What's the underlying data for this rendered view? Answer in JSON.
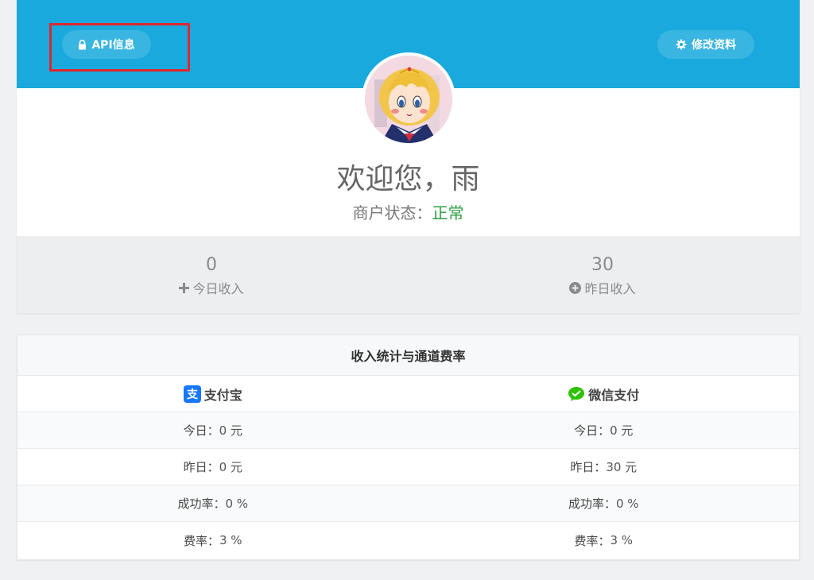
{
  "header": {
    "api_button_label": "API信息",
    "edit_button_label": "修改资料"
  },
  "profile": {
    "welcome_text": "欢迎您，雨",
    "status_label": "商户状态：",
    "status_value": "正常"
  },
  "stats": {
    "today_value": "0",
    "today_label": "今日收入",
    "yesterday_value": "30",
    "yesterday_label": "昨日收入"
  },
  "income_table": {
    "title": "收入统计与通道费率",
    "channels": [
      "支付宝",
      "微信支付"
    ],
    "rows": [
      {
        "alipay_label": "今日：",
        "alipay_value": "0 元",
        "wechat_label": "今日：",
        "wechat_value": "0 元"
      },
      {
        "alipay_label": "昨日：",
        "alipay_value": "0 元",
        "wechat_label": "昨日：",
        "wechat_value": "30 元"
      },
      {
        "alipay_label": "成功率：",
        "alipay_value": "0 %",
        "wechat_label": "成功率：",
        "wechat_value": "0 %"
      },
      {
        "alipay_label": "费率：",
        "alipay_value": "3 %",
        "wechat_label": "费率：",
        "wechat_value": "3 %"
      }
    ]
  },
  "colors": {
    "banner": "#19a9dc",
    "status_ok": "#2f9e44",
    "highlight": "#e0262f",
    "alipay": "#1677ff",
    "wechat": "#2dc100"
  },
  "icons": {
    "api": "lock-icon",
    "edit": "gear-icon",
    "today": "plus-icon",
    "yesterday": "plus-circle-icon",
    "alipay": "alipay-icon",
    "wechat": "wechat-icon"
  }
}
